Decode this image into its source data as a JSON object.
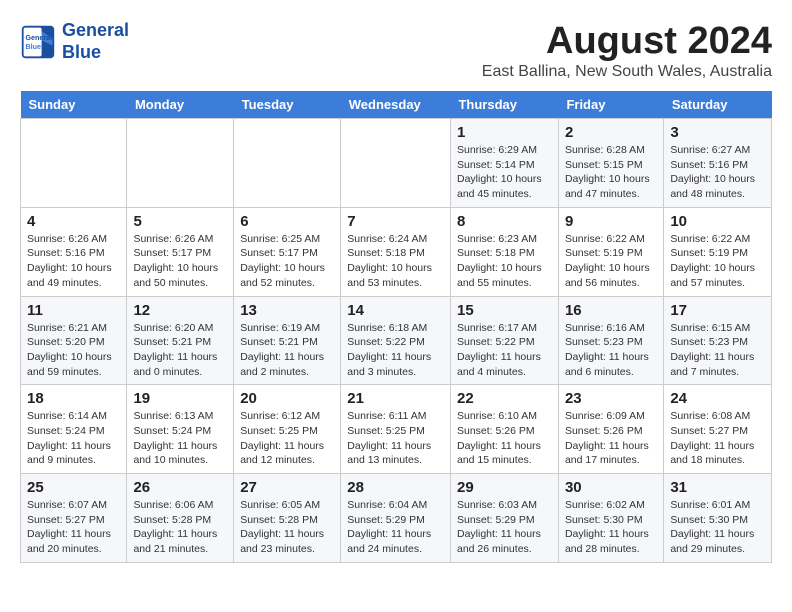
{
  "logo": {
    "line1": "General",
    "line2": "Blue"
  },
  "title": "August 2024",
  "subtitle": "East Ballina, New South Wales, Australia",
  "weekdays": [
    "Sunday",
    "Monday",
    "Tuesday",
    "Wednesday",
    "Thursday",
    "Friday",
    "Saturday"
  ],
  "weeks": [
    [
      {
        "num": "",
        "detail": ""
      },
      {
        "num": "",
        "detail": ""
      },
      {
        "num": "",
        "detail": ""
      },
      {
        "num": "",
        "detail": ""
      },
      {
        "num": "1",
        "detail": "Sunrise: 6:29 AM\nSunset: 5:14 PM\nDaylight: 10 hours and 45 minutes."
      },
      {
        "num": "2",
        "detail": "Sunrise: 6:28 AM\nSunset: 5:15 PM\nDaylight: 10 hours and 47 minutes."
      },
      {
        "num": "3",
        "detail": "Sunrise: 6:27 AM\nSunset: 5:16 PM\nDaylight: 10 hours and 48 minutes."
      }
    ],
    [
      {
        "num": "4",
        "detail": "Sunrise: 6:26 AM\nSunset: 5:16 PM\nDaylight: 10 hours and 49 minutes."
      },
      {
        "num": "5",
        "detail": "Sunrise: 6:26 AM\nSunset: 5:17 PM\nDaylight: 10 hours and 50 minutes."
      },
      {
        "num": "6",
        "detail": "Sunrise: 6:25 AM\nSunset: 5:17 PM\nDaylight: 10 hours and 52 minutes."
      },
      {
        "num": "7",
        "detail": "Sunrise: 6:24 AM\nSunset: 5:18 PM\nDaylight: 10 hours and 53 minutes."
      },
      {
        "num": "8",
        "detail": "Sunrise: 6:23 AM\nSunset: 5:18 PM\nDaylight: 10 hours and 55 minutes."
      },
      {
        "num": "9",
        "detail": "Sunrise: 6:22 AM\nSunset: 5:19 PM\nDaylight: 10 hours and 56 minutes."
      },
      {
        "num": "10",
        "detail": "Sunrise: 6:22 AM\nSunset: 5:19 PM\nDaylight: 10 hours and 57 minutes."
      }
    ],
    [
      {
        "num": "11",
        "detail": "Sunrise: 6:21 AM\nSunset: 5:20 PM\nDaylight: 10 hours and 59 minutes."
      },
      {
        "num": "12",
        "detail": "Sunrise: 6:20 AM\nSunset: 5:21 PM\nDaylight: 11 hours and 0 minutes."
      },
      {
        "num": "13",
        "detail": "Sunrise: 6:19 AM\nSunset: 5:21 PM\nDaylight: 11 hours and 2 minutes."
      },
      {
        "num": "14",
        "detail": "Sunrise: 6:18 AM\nSunset: 5:22 PM\nDaylight: 11 hours and 3 minutes."
      },
      {
        "num": "15",
        "detail": "Sunrise: 6:17 AM\nSunset: 5:22 PM\nDaylight: 11 hours and 4 minutes."
      },
      {
        "num": "16",
        "detail": "Sunrise: 6:16 AM\nSunset: 5:23 PM\nDaylight: 11 hours and 6 minutes."
      },
      {
        "num": "17",
        "detail": "Sunrise: 6:15 AM\nSunset: 5:23 PM\nDaylight: 11 hours and 7 minutes."
      }
    ],
    [
      {
        "num": "18",
        "detail": "Sunrise: 6:14 AM\nSunset: 5:24 PM\nDaylight: 11 hours and 9 minutes."
      },
      {
        "num": "19",
        "detail": "Sunrise: 6:13 AM\nSunset: 5:24 PM\nDaylight: 11 hours and 10 minutes."
      },
      {
        "num": "20",
        "detail": "Sunrise: 6:12 AM\nSunset: 5:25 PM\nDaylight: 11 hours and 12 minutes."
      },
      {
        "num": "21",
        "detail": "Sunrise: 6:11 AM\nSunset: 5:25 PM\nDaylight: 11 hours and 13 minutes."
      },
      {
        "num": "22",
        "detail": "Sunrise: 6:10 AM\nSunset: 5:26 PM\nDaylight: 11 hours and 15 minutes."
      },
      {
        "num": "23",
        "detail": "Sunrise: 6:09 AM\nSunset: 5:26 PM\nDaylight: 11 hours and 17 minutes."
      },
      {
        "num": "24",
        "detail": "Sunrise: 6:08 AM\nSunset: 5:27 PM\nDaylight: 11 hours and 18 minutes."
      }
    ],
    [
      {
        "num": "25",
        "detail": "Sunrise: 6:07 AM\nSunset: 5:27 PM\nDaylight: 11 hours and 20 minutes."
      },
      {
        "num": "26",
        "detail": "Sunrise: 6:06 AM\nSunset: 5:28 PM\nDaylight: 11 hours and 21 minutes."
      },
      {
        "num": "27",
        "detail": "Sunrise: 6:05 AM\nSunset: 5:28 PM\nDaylight: 11 hours and 23 minutes."
      },
      {
        "num": "28",
        "detail": "Sunrise: 6:04 AM\nSunset: 5:29 PM\nDaylight: 11 hours and 24 minutes."
      },
      {
        "num": "29",
        "detail": "Sunrise: 6:03 AM\nSunset: 5:29 PM\nDaylight: 11 hours and 26 minutes."
      },
      {
        "num": "30",
        "detail": "Sunrise: 6:02 AM\nSunset: 5:30 PM\nDaylight: 11 hours and 28 minutes."
      },
      {
        "num": "31",
        "detail": "Sunrise: 6:01 AM\nSunset: 5:30 PM\nDaylight: 11 hours and 29 minutes."
      }
    ]
  ]
}
